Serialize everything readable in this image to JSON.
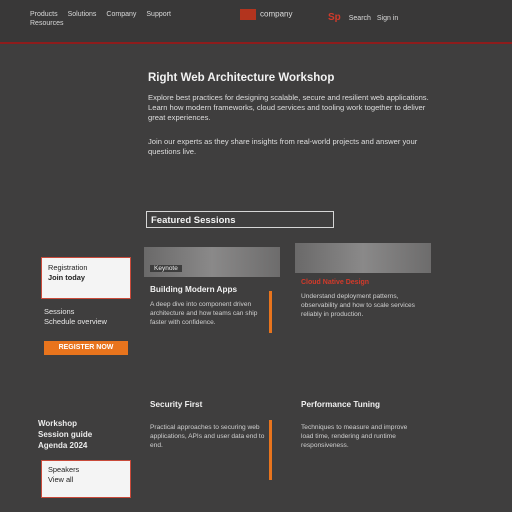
{
  "nav": {
    "left_links": [
      "Products",
      "Solutions",
      "Company",
      "Support"
    ],
    "left_sub": "Resources",
    "logo_text": "company",
    "right_badge": "Sp",
    "right_links": [
      "Search",
      "Sign in"
    ]
  },
  "intro": {
    "heading": "Right Web Architecture Workshop",
    "paragraph1": "Explore best practices for designing scalable, secure and resilient web applications. Learn how modern frameworks, cloud services and tooling work together to deliver great experiences.",
    "paragraph2": "Join our experts as they share insights from real-world projects and answer your questions live."
  },
  "section": {
    "title": "Featured Sessions"
  },
  "sidebar": {
    "box1_line1": "Registration",
    "box1_line2": "Join today",
    "label1_line1": "Sessions",
    "label1_line2": "Schedule overview",
    "button_label": "REGISTER NOW",
    "label2_line1": "Workshop",
    "label2_line2": "Session guide",
    "label2_line3": "Agenda 2024",
    "box2_line1": "Speakers",
    "box2_line2": "View all"
  },
  "cards": [
    {
      "tag": "Keynote",
      "title": "Building Modern Apps",
      "label": "",
      "body": "A deep dive into component driven architecture and how teams can ship faster with confidence."
    },
    {
      "tag": "",
      "title": "",
      "label": "Cloud Native Design",
      "body": "Understand deployment patterns, observability and how to scale services reliably in production."
    },
    {
      "tag": "",
      "title": "Security First",
      "label": "",
      "body": "Practical approaches to securing web applications, APIs and user data end to end."
    },
    {
      "tag": "",
      "title": "Performance Tuning",
      "label": "",
      "body": "Techniques to measure and improve load time, rendering and runtime responsiveness."
    }
  ]
}
